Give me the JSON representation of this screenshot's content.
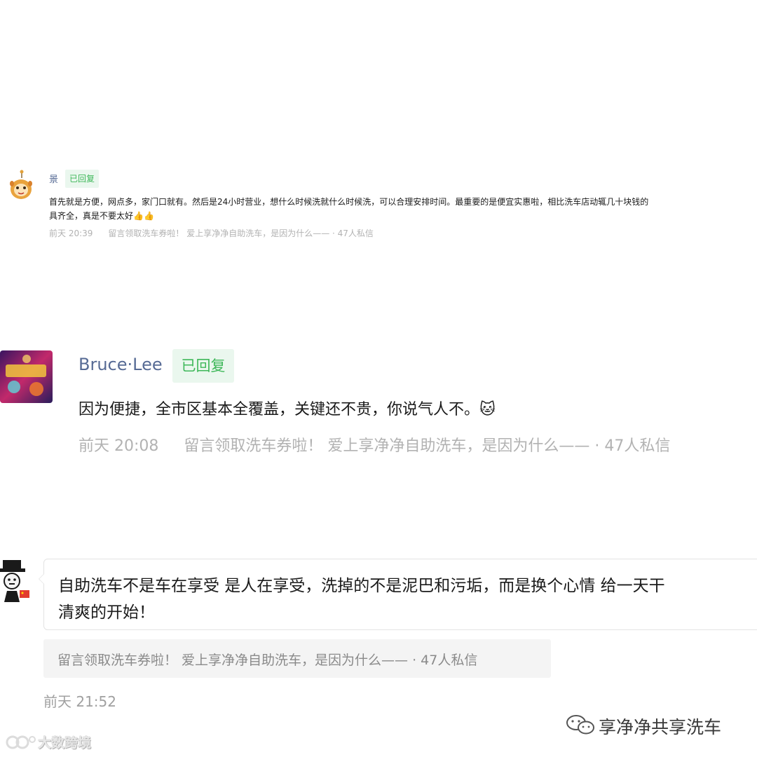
{
  "comments": [
    {
      "nickname": "景",
      "badge": "已回复",
      "text_lines": [
        "首先就是方便，网点多，家门口就有。然后是24小时营业，想什么时候洗就什么时候洗，可以合理安排时间。最重要的是便宜实惠啦，相比洗车店动辄几十块钱的",
        "具齐全，真是不要太好👍👍"
      ],
      "time": "前天 20:39",
      "source": "留言领取洗车券啦！ 爱上享净净自助洗车，是因为什么—— · 47人私信"
    },
    {
      "nickname": "Bruce·Lee",
      "badge": "已回复",
      "text_lines": [
        "因为便捷，全市区基本全覆盖，关键还不贵，你说气人不。🐱"
      ],
      "time": "前天 20:08",
      "source": "留言领取洗车券啦！ 爱上享净净自助洗车，是因为什么—— · 47人私信"
    },
    {
      "text_lines": [
        "自助洗车不是车在享受 是人在享受，洗掉的不是泥巴和污垢，而是换个心情 给一天干",
        "清爽的开始！"
      ],
      "source": "留言领取洗车券啦！ 爱上享净净自助洗车，是因为什么—— · 47人私信",
      "time": "前天 21:52"
    }
  ],
  "watermark": {
    "wechat_account": "享净净共享洗车",
    "source_logo": "大数跨境"
  }
}
